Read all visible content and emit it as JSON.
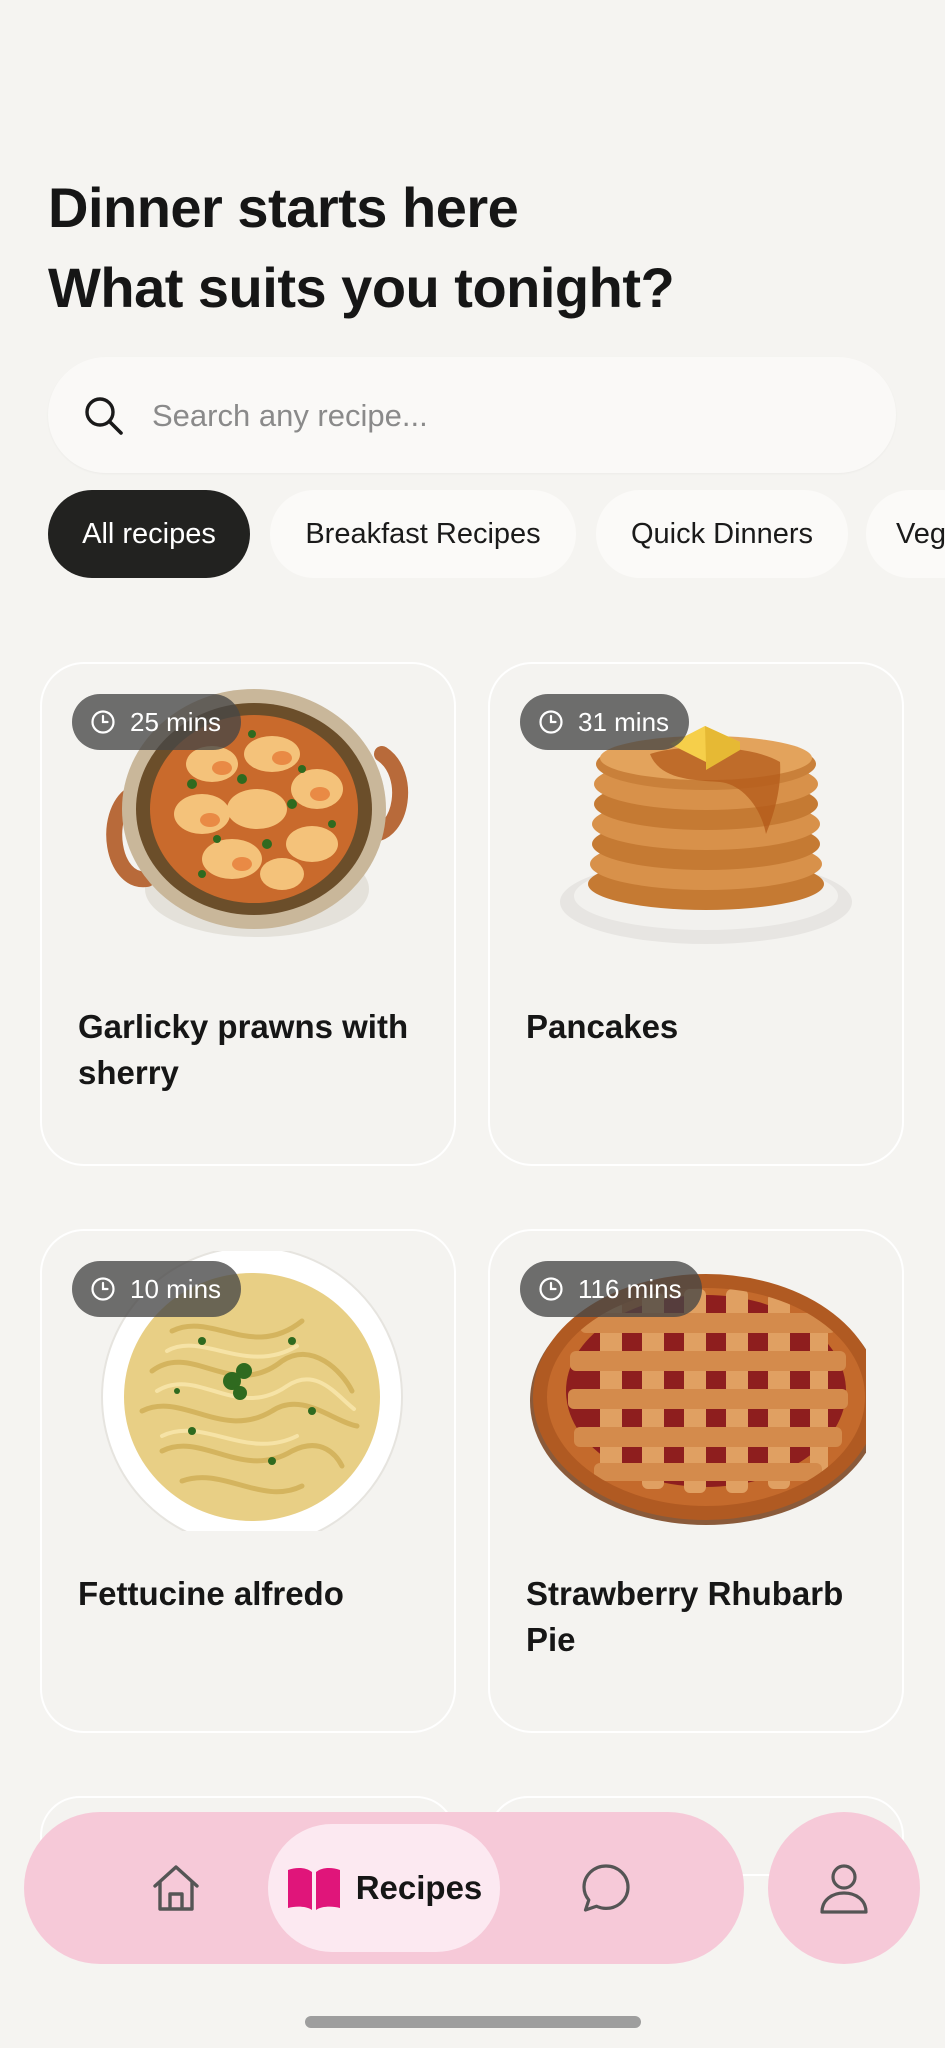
{
  "header": {
    "line1": "Dinner starts here",
    "line2": "What suits you tonight?"
  },
  "search": {
    "placeholder": "Search any recipe...",
    "icon": "search-icon"
  },
  "filters": [
    {
      "label": "All recipes",
      "active": true
    },
    {
      "label": "Breakfast Recipes",
      "active": false
    },
    {
      "label": "Quick Dinners",
      "active": false
    },
    {
      "label": "Veg",
      "active": false
    }
  ],
  "recipes": [
    {
      "title": "Garlicky prawns with sherry",
      "time": "25 mins",
      "image": "prawns-pot"
    },
    {
      "title": "Pancakes",
      "time": "31 mins",
      "image": "pancake-stack"
    },
    {
      "title": "Fettucine alfredo",
      "time": "10 mins",
      "image": "pasta-plate"
    },
    {
      "title": "Strawberry Rhubarb Pie",
      "time": "116 mins",
      "image": "lattice-pie"
    }
  ],
  "nav": {
    "items": [
      {
        "name": "home",
        "icon": "home-icon"
      },
      {
        "name": "recipes",
        "label": "Recipes",
        "icon": "book-icon",
        "active": true
      },
      {
        "name": "chat",
        "icon": "chat-icon"
      }
    ],
    "profile_icon": "user-icon"
  },
  "colors": {
    "background": "#f5f4f1",
    "nav_pink": "#f6c9d8",
    "active_nav": "#fce9f1",
    "accent_magenta": "#e0157a",
    "active_chip": "#222220"
  }
}
